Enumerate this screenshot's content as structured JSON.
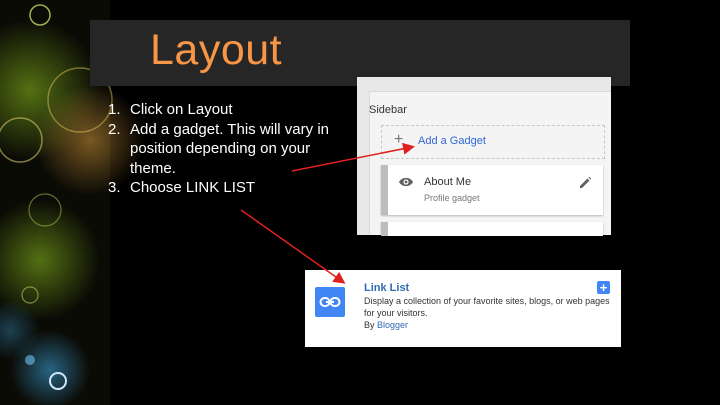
{
  "slide": {
    "title": "Layout",
    "title_color": "#f79646",
    "steps": [
      {
        "num": "1.",
        "text": "Click on Layout"
      },
      {
        "num": "2.",
        "text": "Add a gadget. This will vary in position depending on your theme."
      },
      {
        "num": "3.",
        "text": "Choose LINK LIST"
      }
    ]
  },
  "sidebar_screenshot": {
    "section_title": "Sidebar",
    "add_gadget_label": "Add a Gadget",
    "plus_icon": "plus-icon",
    "gadgets": [
      {
        "name": "About Me",
        "type": "Profile gadget",
        "icon": "eye-icon",
        "action_icon": "edit-icon"
      }
    ]
  },
  "linklist_screenshot": {
    "title": "Link List",
    "description": "Display a collection of your favorite sites, blogs, or web pages for your visitors.",
    "by_prefix": "By ",
    "author": "Blogger",
    "icon": "link-icon",
    "add_icon": "plus-icon",
    "accent": "#4285f4"
  },
  "arrow_color": "#e0201e"
}
